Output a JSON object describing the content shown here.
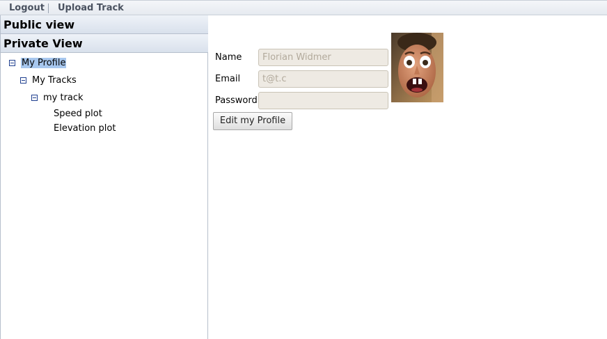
{
  "menubar": {
    "logout_label": "Logout",
    "upload_label": "Upload Track"
  },
  "leftpanel": {
    "public_header": "Public view",
    "private_header": "Private View",
    "tree": {
      "my_profile": "My Profile",
      "my_tracks": "My Tracks",
      "my_track": "my track",
      "speed_plot": "Speed plot",
      "elevation_plot": "Elevation plot"
    }
  },
  "profile": {
    "name_label": "Name",
    "name_value": "Florian Widmer",
    "email_label": "Email",
    "email_value": "t@t.c",
    "password_label": "Password",
    "password_value": "",
    "edit_button": "Edit my Profile"
  },
  "colors": {
    "selection": "#a7c7ee",
    "toggle": "#1f3f8f",
    "input_bg": "#eeeae3"
  }
}
